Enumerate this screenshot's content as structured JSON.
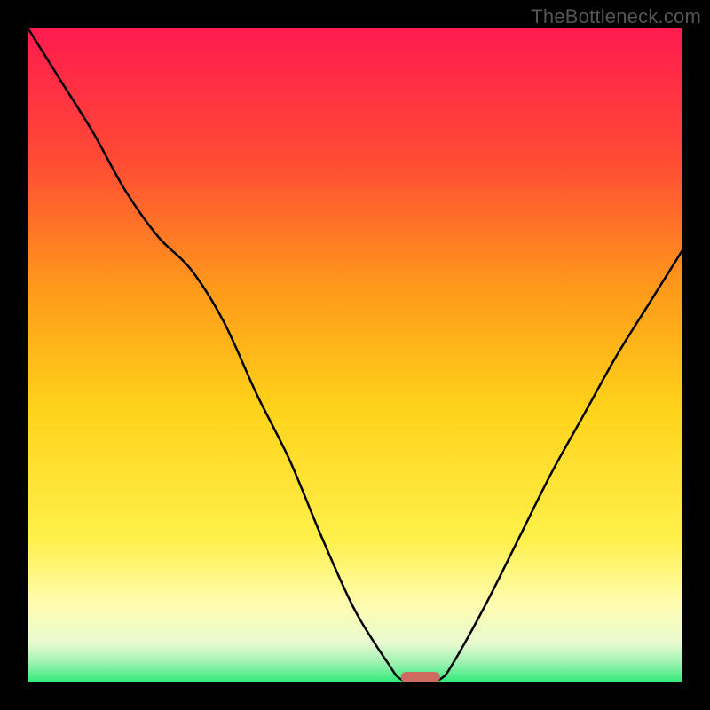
{
  "attribution": "TheBottleneck.com",
  "colors": {
    "frame": "#000000",
    "grad_top": "#ff1a4f",
    "grad_upper_mid": "#ff6a2a",
    "grad_mid": "#ffd21a",
    "grad_lower_mid": "#fffa8a",
    "grad_pale": "#eafcd2",
    "grad_green": "#2eea7a",
    "curve": "#000000",
    "marker": "#cf6a61"
  },
  "chart_data": {
    "type": "line",
    "title": "",
    "xlabel": "",
    "ylabel": "",
    "xlim": [
      0,
      100
    ],
    "ylim": [
      0,
      100
    ],
    "series": [
      {
        "name": "bottleneck-curve",
        "x": [
          0,
          5,
          10,
          15,
          20,
          25,
          30,
          35,
          40,
          45,
          50,
          55,
          57,
          60,
          63,
          65,
          70,
          75,
          80,
          85,
          90,
          95,
          100
        ],
        "y": [
          100,
          92,
          84,
          75,
          68,
          63,
          55,
          44,
          34,
          22,
          11,
          3,
          0.5,
          0,
          0.5,
          3,
          12,
          22,
          32,
          41,
          50,
          58,
          66
        ]
      }
    ],
    "annotations": [
      {
        "name": "optimal-marker",
        "type": "segment",
        "x": [
          57,
          63
        ],
        "y": [
          0,
          0
        ]
      }
    ]
  }
}
